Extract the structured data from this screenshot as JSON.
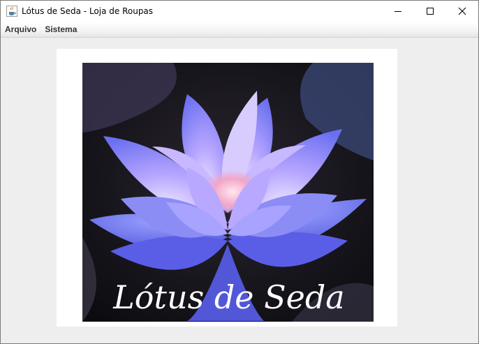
{
  "window": {
    "title": "Lótus de Seda - Loja de Roupas",
    "icon": "java-cup-icon",
    "controls": [
      "minimize-icon",
      "maximize-icon",
      "close-icon"
    ]
  },
  "menubar": {
    "items": [
      {
        "label": "Arquivo"
      },
      {
        "label": "Sistema"
      }
    ]
  },
  "main": {
    "logo_text": "Lótus de Seda",
    "colors": {
      "background": "#eeeeee",
      "panel": "#ffffff",
      "petal": "#8c8cf5",
      "petal_light": "#e8d8ff",
      "center": "#f3a6c6",
      "image_bg": "#111111"
    }
  }
}
